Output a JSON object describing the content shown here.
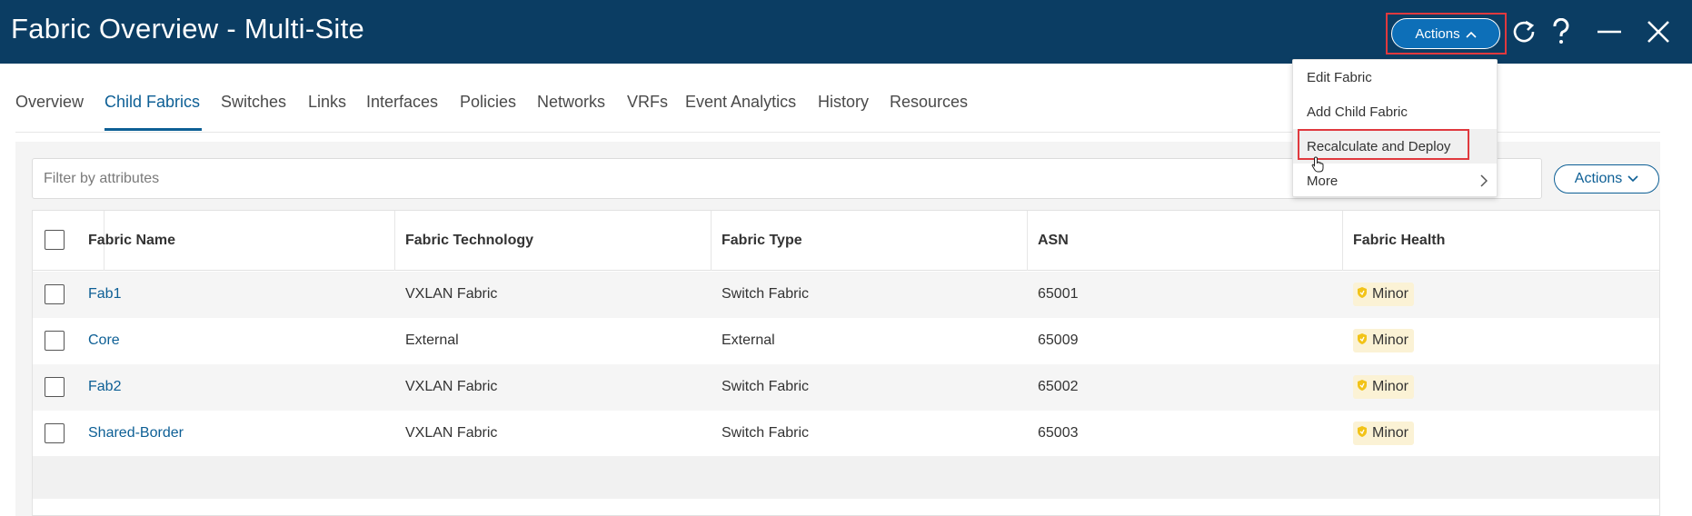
{
  "header": {
    "title": "Fabric Overview - Multi-Site",
    "actions_label": "Actions"
  },
  "tabs": [
    {
      "label": "Overview"
    },
    {
      "label": "Child Fabrics"
    },
    {
      "label": "Switches"
    },
    {
      "label": "Links"
    },
    {
      "label": "Interfaces"
    },
    {
      "label": "Policies"
    },
    {
      "label": "Networks"
    },
    {
      "label": "VRFs"
    },
    {
      "label": "Event Analytics"
    },
    {
      "label": "History"
    },
    {
      "label": "Resources"
    }
  ],
  "active_tab": "Child Fabrics",
  "filter": {
    "placeholder": "Filter by attributes",
    "value": ""
  },
  "table_actions_label": "Actions",
  "table": {
    "columns": [
      "Fabric Name",
      "Fabric Technology",
      "Fabric Type",
      "ASN",
      "Fabric Health"
    ],
    "rows": [
      {
        "name": "Fab1",
        "technology": "VXLAN Fabric",
        "type": "Switch Fabric",
        "asn": "65001",
        "health": "Minor"
      },
      {
        "name": "Core",
        "technology": "External",
        "type": "External",
        "asn": "65009",
        "health": "Minor"
      },
      {
        "name": "Fab2",
        "technology": "VXLAN Fabric",
        "type": "Switch Fabric",
        "asn": "65002",
        "health": "Minor"
      },
      {
        "name": "Shared-Border",
        "technology": "VXLAN Fabric",
        "type": "Switch Fabric",
        "asn": "65003",
        "health": "Minor"
      }
    ]
  },
  "actions_menu": {
    "items": [
      {
        "label": "Edit Fabric"
      },
      {
        "label": "Add Child Fabric"
      },
      {
        "label": "Recalculate and Deploy"
      },
      {
        "label": "More"
      }
    ]
  },
  "colors": {
    "header_bg": "#0b3d63",
    "accent": "#0d5f95",
    "highlight_border": "#e0393e",
    "health_minor": "#f2c318"
  },
  "icons": [
    "refresh-icon",
    "help-icon",
    "minimize-icon",
    "close-icon",
    "chevron-up-icon",
    "chevron-down-icon",
    "chevron-right-icon",
    "shield-icon",
    "hand-cursor-icon"
  ]
}
